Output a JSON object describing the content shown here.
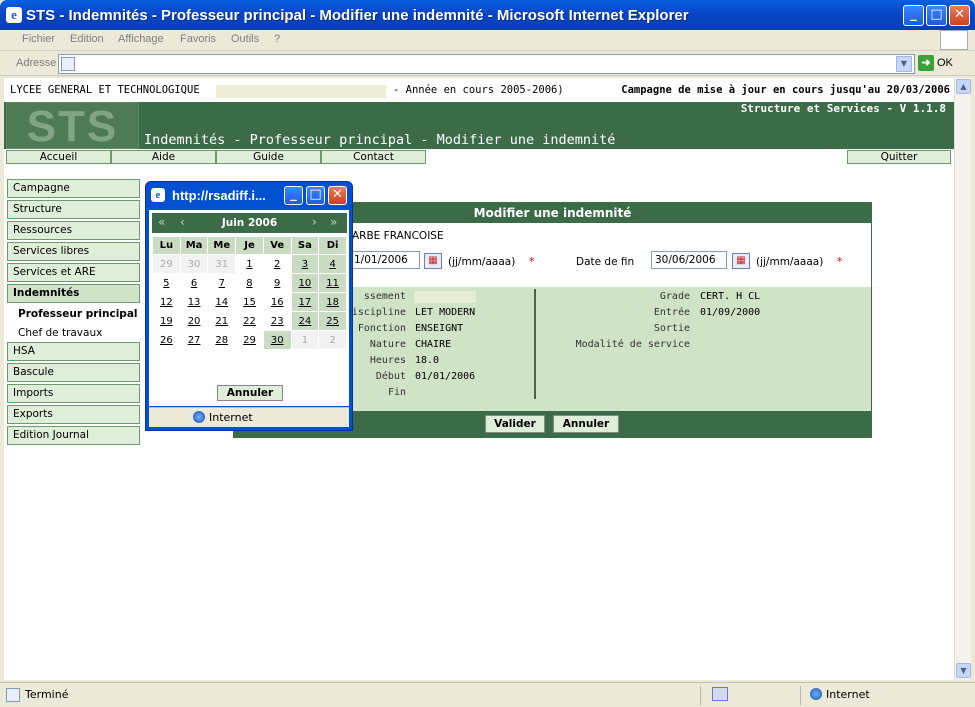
{
  "window": {
    "title": "STS - Indemnités - Professeur principal - Modifier une indemnité - Microsoft Internet Explorer"
  },
  "menu": [
    "Fichier",
    "Edition",
    "Affichage",
    "Favoris",
    "Outils",
    "?"
  ],
  "address": {
    "label": "Adresse",
    "go": "OK"
  },
  "page": {
    "school": "LYCEE GENERAL ET TECHNOLOGIQUE",
    "year": "- Année en cours 2005-2006)",
    "campaign": "Campagne de mise à jour en cours jusqu'au 20/03/2006",
    "version": "Structure et Services - V 1.1.8",
    "logo": "STS",
    "title": "Indemnités - Professeur principal - Modifier une indemnité"
  },
  "nav": {
    "accueil": "Accueil",
    "aide": "Aide",
    "guide": "Guide",
    "contact": "Contact",
    "quitter": "Quitter"
  },
  "sidebar": {
    "items": [
      "Campagne",
      "Structure",
      "Ressources",
      "Services libres",
      "Services et ARE",
      "Indemnités"
    ],
    "sub": [
      "Professeur principal",
      "Chef de travaux"
    ],
    "items2": [
      "HSA",
      "Bascule",
      "Imports",
      "Exports",
      "Edition Journal"
    ]
  },
  "form": {
    "header": "Modifier une indemnité",
    "name": "ARBE FRANCOISE",
    "start_value": "1/01/2006",
    "format": "(jj/mm/aaaa)",
    "required": "*",
    "end_label": "Date de fin",
    "end_value": "30/06/2006",
    "left": [
      {
        "k": "ssement",
        "v": ""
      },
      {
        "k": "Discipline",
        "v": "LET MODERN"
      },
      {
        "k": "Fonction",
        "v": "ENSEIGNT"
      },
      {
        "k": "Nature",
        "v": "CHAIRE"
      },
      {
        "k": "Heures",
        "v": "18.0"
      },
      {
        "k": "Début",
        "v": "01/01/2006"
      },
      {
        "k": "Fin",
        "v": ""
      }
    ],
    "right": [
      {
        "k": "Grade",
        "v": "CERT. H CL"
      },
      {
        "k": "Entrée",
        "v": "01/09/2000"
      },
      {
        "k": "Sortie",
        "v": ""
      },
      {
        "k": "Modalité de service",
        "v": ""
      }
    ],
    "valider": "Valider",
    "annuler": "Annuler"
  },
  "popup": {
    "title": "http://rsadiff.i...",
    "month": "Juin 2006",
    "days": [
      "Lu",
      "Ma",
      "Me",
      "Je",
      "Ve",
      "Sa",
      "Di"
    ],
    "weeks": [
      [
        "29",
        "30",
        "31",
        "1",
        "2",
        "3",
        "4"
      ],
      [
        "5",
        "6",
        "7",
        "8",
        "9",
        "10",
        "11"
      ],
      [
        "12",
        "13",
        "14",
        "15",
        "16",
        "17",
        "18"
      ],
      [
        "19",
        "20",
        "21",
        "22",
        "23",
        "24",
        "25"
      ],
      [
        "26",
        "27",
        "28",
        "29",
        "30",
        "1",
        "2"
      ]
    ],
    "cancel": "Annuler",
    "zone": "Internet"
  },
  "status": {
    "text": "Terminé",
    "zone": "Internet"
  }
}
